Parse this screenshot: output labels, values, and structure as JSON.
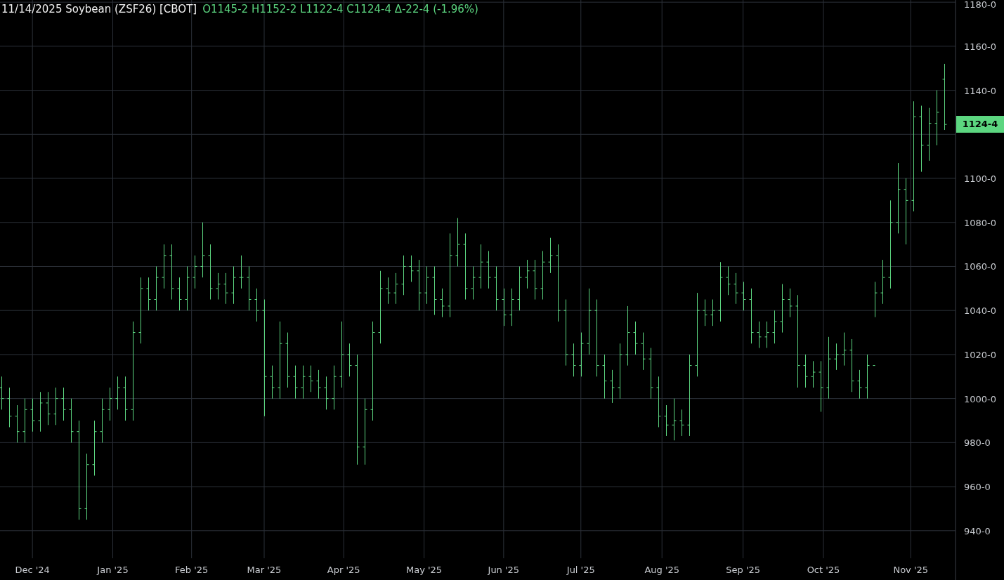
{
  "header": {
    "title": "11/14/2025 Soybean (ZSF26) [CBOT]",
    "quote": "O1145-2 H1152-2 L1122-4 C1124-4 Δ-22-4 (-1.96%)"
  },
  "price_chart": {
    "kind": "picture",
    "price_axis_labels": [
      "1180-0",
      "1160-0",
      "1140-0",
      "1100-0",
      "1080-0",
      "1060-0",
      "1040-0",
      "1020-0",
      "1000-0",
      "980-0",
      "960-0",
      "940-0"
    ],
    "date_axis_labels": [
      "Dec '24",
      "Jan '25",
      "Feb '25",
      "Mar '25",
      "Apr '25",
      "May '25",
      "Jun '25",
      "Jul '25",
      "Aug '25",
      "Sep '25",
      "Oct '25",
      "Nov '25"
    ],
    "last_price_tag": "1124-4"
  }
}
